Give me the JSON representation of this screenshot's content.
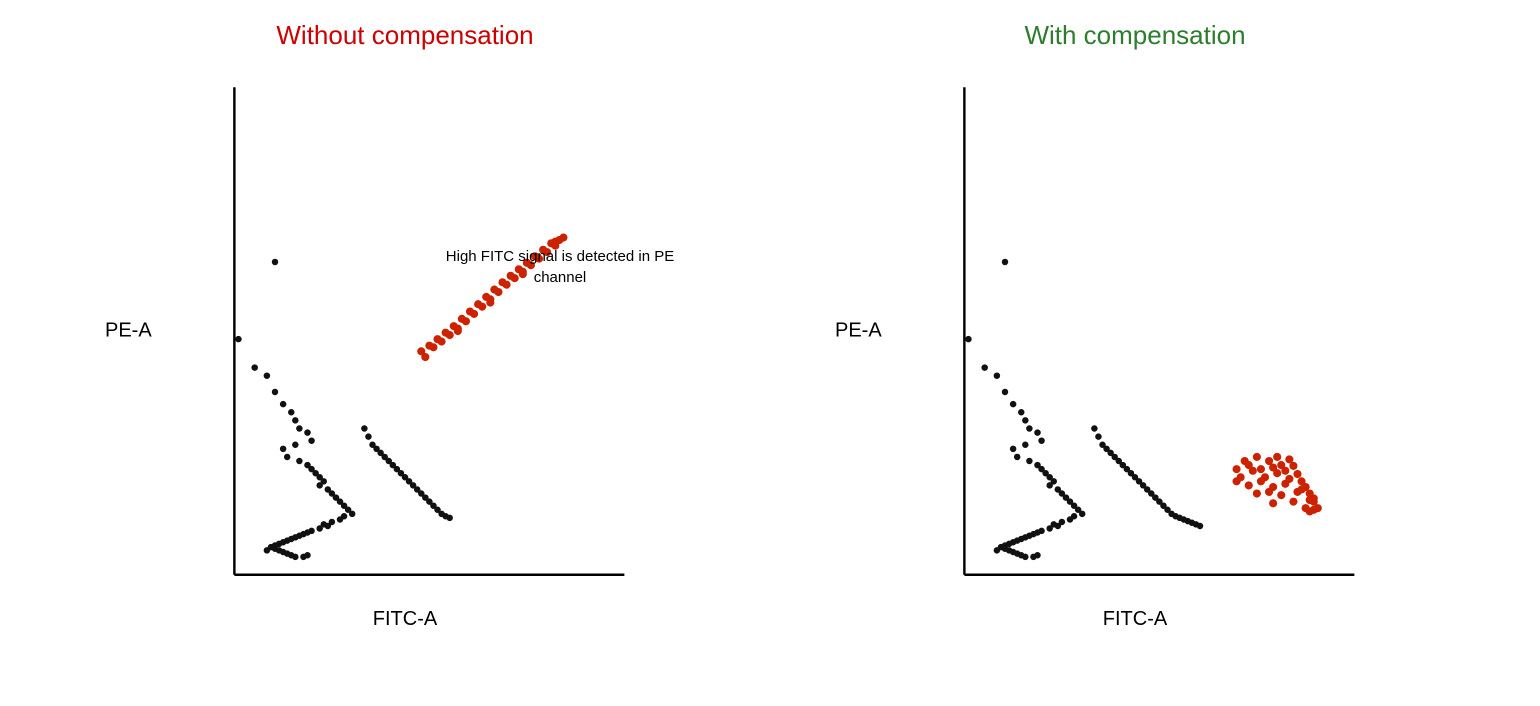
{
  "left_chart": {
    "title": "Without compensation",
    "title_color": "#cc0000",
    "x_label": "FITC-A",
    "y_label": "PE-A",
    "annotation": "High FITC signal\nis detected in PE\nchannel",
    "black_dots": [
      [
        130,
        235
      ],
      [
        85,
        330
      ],
      [
        105,
        365
      ],
      [
        120,
        375
      ],
      [
        130,
        395
      ],
      [
        140,
        410
      ],
      [
        150,
        420
      ],
      [
        155,
        430
      ],
      [
        160,
        440
      ],
      [
        170,
        445
      ],
      [
        175,
        455
      ],
      [
        155,
        460
      ],
      [
        140,
        465
      ],
      [
        145,
        475
      ],
      [
        160,
        480
      ],
      [
        170,
        485
      ],
      [
        175,
        490
      ],
      [
        180,
        495
      ],
      [
        185,
        500
      ],
      [
        190,
        505
      ],
      [
        185,
        510
      ],
      [
        195,
        515
      ],
      [
        200,
        520
      ],
      [
        205,
        525
      ],
      [
        210,
        530
      ],
      [
        215,
        535
      ],
      [
        220,
        540
      ],
      [
        225,
        545
      ],
      [
        215,
        548
      ],
      [
        210,
        552
      ],
      [
        200,
        555
      ],
      [
        190,
        558
      ],
      [
        195,
        560
      ],
      [
        185,
        563
      ],
      [
        175,
        566
      ],
      [
        170,
        568
      ],
      [
        165,
        570
      ],
      [
        160,
        572
      ],
      [
        155,
        574
      ],
      [
        150,
        576
      ],
      [
        145,
        578
      ],
      [
        140,
        580
      ],
      [
        135,
        582
      ],
      [
        130,
        584
      ],
      [
        125,
        586
      ],
      [
        130,
        588
      ],
      [
        135,
        590
      ],
      [
        140,
        592
      ],
      [
        145,
        594
      ],
      [
        150,
        596
      ],
      [
        155,
        598
      ],
      [
        165,
        598
      ],
      [
        170,
        596
      ],
      [
        120,
        590
      ],
      [
        240,
        440
      ],
      [
        245,
        450
      ],
      [
        250,
        460
      ],
      [
        255,
        465
      ],
      [
        260,
        470
      ],
      [
        265,
        475
      ],
      [
        270,
        480
      ],
      [
        275,
        485
      ],
      [
        280,
        490
      ],
      [
        285,
        495
      ],
      [
        290,
        500
      ],
      [
        295,
        505
      ],
      [
        300,
        510
      ],
      [
        305,
        515
      ],
      [
        310,
        520
      ],
      [
        315,
        525
      ],
      [
        320,
        530
      ],
      [
        325,
        535
      ],
      [
        330,
        540
      ],
      [
        335,
        545
      ],
      [
        340,
        548
      ],
      [
        345,
        550
      ]
    ],
    "red_dots": [
      [
        310,
        345
      ],
      [
        320,
        338
      ],
      [
        330,
        330
      ],
      [
        340,
        322
      ],
      [
        350,
        314
      ],
      [
        360,
        305
      ],
      [
        370,
        296
      ],
      [
        380,
        287
      ],
      [
        390,
        278
      ],
      [
        400,
        269
      ],
      [
        410,
        260
      ],
      [
        420,
        252
      ],
      [
        430,
        244
      ],
      [
        440,
        236
      ],
      [
        450,
        228
      ],
      [
        460,
        220
      ],
      [
        470,
        212
      ],
      [
        325,
        340
      ],
      [
        335,
        333
      ],
      [
        345,
        325
      ],
      [
        355,
        317
      ],
      [
        365,
        308
      ],
      [
        375,
        299
      ],
      [
        385,
        290
      ],
      [
        395,
        281
      ],
      [
        405,
        272
      ],
      [
        415,
        263
      ],
      [
        425,
        255
      ],
      [
        435,
        247
      ],
      [
        445,
        239
      ],
      [
        455,
        231
      ],
      [
        465,
        223
      ],
      [
        475,
        215
      ],
      [
        315,
        352
      ],
      [
        355,
        320
      ],
      [
        395,
        285
      ],
      [
        435,
        250
      ],
      [
        475,
        210
      ],
      [
        480,
        208
      ],
      [
        485,
        205
      ]
    ]
  },
  "right_chart": {
    "title": "With compensation",
    "title_color": "#2d7d2d",
    "x_label": "FITC-A",
    "y_label": "PE-A",
    "black_dots": [
      [
        130,
        235
      ],
      [
        85,
        330
      ],
      [
        105,
        365
      ],
      [
        120,
        375
      ],
      [
        130,
        395
      ],
      [
        140,
        410
      ],
      [
        150,
        420
      ],
      [
        155,
        430
      ],
      [
        160,
        440
      ],
      [
        170,
        445
      ],
      [
        175,
        455
      ],
      [
        155,
        460
      ],
      [
        140,
        465
      ],
      [
        145,
        475
      ],
      [
        160,
        480
      ],
      [
        170,
        485
      ],
      [
        175,
        490
      ],
      [
        180,
        495
      ],
      [
        185,
        500
      ],
      [
        190,
        505
      ],
      [
        185,
        510
      ],
      [
        195,
        515
      ],
      [
        200,
        520
      ],
      [
        205,
        525
      ],
      [
        210,
        530
      ],
      [
        215,
        535
      ],
      [
        220,
        540
      ],
      [
        225,
        545
      ],
      [
        215,
        548
      ],
      [
        210,
        552
      ],
      [
        200,
        555
      ],
      [
        190,
        558
      ],
      [
        195,
        560
      ],
      [
        185,
        563
      ],
      [
        175,
        566
      ],
      [
        170,
        568
      ],
      [
        165,
        570
      ],
      [
        160,
        572
      ],
      [
        155,
        574
      ],
      [
        150,
        576
      ],
      [
        145,
        578
      ],
      [
        140,
        580
      ],
      [
        135,
        582
      ],
      [
        130,
        584
      ],
      [
        125,
        586
      ],
      [
        130,
        588
      ],
      [
        135,
        590
      ],
      [
        140,
        592
      ],
      [
        145,
        594
      ],
      [
        150,
        596
      ],
      [
        155,
        598
      ],
      [
        165,
        598
      ],
      [
        170,
        596
      ],
      [
        120,
        590
      ],
      [
        240,
        440
      ],
      [
        245,
        450
      ],
      [
        250,
        460
      ],
      [
        255,
        465
      ],
      [
        260,
        470
      ],
      [
        265,
        475
      ],
      [
        270,
        480
      ],
      [
        275,
        485
      ],
      [
        280,
        490
      ],
      [
        285,
        495
      ],
      [
        290,
        500
      ],
      [
        295,
        505
      ],
      [
        300,
        510
      ],
      [
        305,
        515
      ],
      [
        310,
        520
      ],
      [
        315,
        525
      ],
      [
        320,
        530
      ],
      [
        325,
        535
      ],
      [
        330,
        540
      ],
      [
        335,
        545
      ],
      [
        340,
        548
      ],
      [
        345,
        550
      ],
      [
        350,
        552
      ],
      [
        355,
        554
      ],
      [
        360,
        556
      ],
      [
        365,
        558
      ],
      [
        370,
        560
      ]
    ],
    "red_dots": [
      [
        415,
        490
      ],
      [
        425,
        480
      ],
      [
        430,
        485
      ],
      [
        440,
        475
      ],
      [
        445,
        490
      ],
      [
        455,
        480
      ],
      [
        460,
        488
      ],
      [
        465,
        475
      ],
      [
        470,
        485
      ],
      [
        475,
        492
      ],
      [
        480,
        478
      ],
      [
        485,
        486
      ],
      [
        490,
        496
      ],
      [
        495,
        505
      ],
      [
        500,
        512
      ],
      [
        505,
        520
      ],
      [
        510,
        526
      ],
      [
        420,
        500
      ],
      [
        435,
        492
      ],
      [
        450,
        500
      ],
      [
        465,
        495
      ],
      [
        480,
        502
      ],
      [
        495,
        515
      ],
      [
        510,
        530
      ],
      [
        430,
        510
      ],
      [
        445,
        505
      ],
      [
        460,
        512
      ],
      [
        475,
        508
      ],
      [
        490,
        518
      ],
      [
        505,
        528
      ],
      [
        440,
        520
      ],
      [
        455,
        518
      ],
      [
        470,
        522
      ],
      [
        485,
        530
      ],
      [
        500,
        538
      ],
      [
        415,
        505
      ],
      [
        460,
        532
      ],
      [
        505,
        542
      ],
      [
        510,
        540
      ],
      [
        515,
        538
      ]
    ]
  }
}
